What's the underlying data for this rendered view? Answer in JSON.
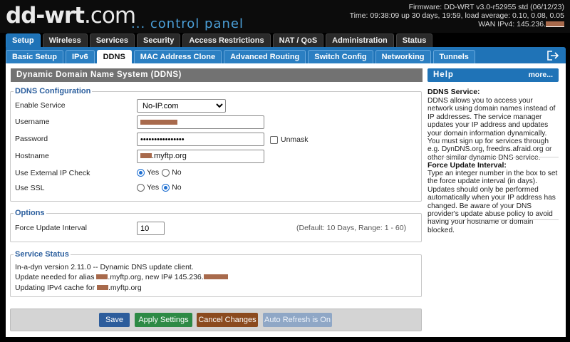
{
  "header": {
    "logo": "dd-wrt",
    "logo_tld": ".com",
    "logo_sub": "... control panel",
    "firmware": "Firmware: DD-WRT v3.0-r52955 std (06/12/23)",
    "time": "Time: 09:38:09 up 30 days, 19:59, load average: 0.10, 0.08, 0.05",
    "wan_label": "WAN IPv4: 145.236."
  },
  "main_tabs": [
    {
      "label": "Setup",
      "active": true
    },
    {
      "label": "Wireless"
    },
    {
      "label": "Services"
    },
    {
      "label": "Security"
    },
    {
      "label": "Access Restrictions"
    },
    {
      "label": "NAT / QoS"
    },
    {
      "label": "Administration"
    },
    {
      "label": "Status"
    }
  ],
  "sub_tabs": [
    {
      "label": "Basic Setup"
    },
    {
      "label": "IPv6"
    },
    {
      "label": "DDNS",
      "active": true
    },
    {
      "label": "MAC Address Clone"
    },
    {
      "label": "Advanced Routing"
    },
    {
      "label": "Switch Config"
    },
    {
      "label": "Networking"
    },
    {
      "label": "Tunnels"
    }
  ],
  "page_title": "Dynamic Domain Name System (DDNS)",
  "ddns_config": {
    "legend": "DDNS Configuration",
    "enable_service": {
      "label": "Enable Service",
      "value": "No-IP.com"
    },
    "username": {
      "label": "Username",
      "value": ""
    },
    "password": {
      "label": "Password",
      "value": "••••••••••••••••",
      "unmask": "Unmask"
    },
    "hostname": {
      "label": "Hostname",
      "value": ".myftp.org"
    },
    "external_ip": {
      "label": "Use External IP Check",
      "yes": "Yes",
      "no": "No",
      "selected": "yes"
    },
    "ssl": {
      "label": "Use SSL",
      "yes": "Yes",
      "no": "No",
      "selected": "no"
    }
  },
  "options": {
    "legend": "Options",
    "force_update": {
      "label": "Force Update Interval",
      "value": "10",
      "hint": "(Default: 10 Days, Range: 1 - 60)"
    }
  },
  "service_status": {
    "legend": "Service Status",
    "line1": "In-a-dyn version 2.11.0 -- Dynamic DNS update client.",
    "line2_a": "Update needed for alias ",
    "line2_b": ".myftp.org, new IP# 145.236.",
    "line3_a": "Updating IPv4 cache for ",
    "line3_b": ".myftp.org"
  },
  "buttons": {
    "save": "Save",
    "apply": "Apply Settings",
    "cancel": "Cancel Changes",
    "refresh": "Auto Refresh is On"
  },
  "help": {
    "title": "Help",
    "more": "more...",
    "s1_title": "DDNS Service:",
    "s1_text": "DDNS allows you to access your network using domain names instead of IP addresses. The service manager updates your IP address and updates your domain information dynamically. You must sign up for services through e.g. DynDNS.org, freedns.afraid.org or other similar dynamic DNS service.",
    "s2_title": "Force Update Interval:",
    "s2_text": "Type an integer number in the box to set the force update interval (in days). Updates should only be performed automatically when your IP address has changed. Be aware of your DNS provider's update abuse policy to avoid having your hostname or domain blocked."
  },
  "colors": {
    "accent": "#1f73b7",
    "save": "#2d5d9c",
    "apply": "#2d8a45",
    "cancel": "#8b4a1e",
    "refresh": "#8fa7c6",
    "redaction": "#a86a4c"
  }
}
